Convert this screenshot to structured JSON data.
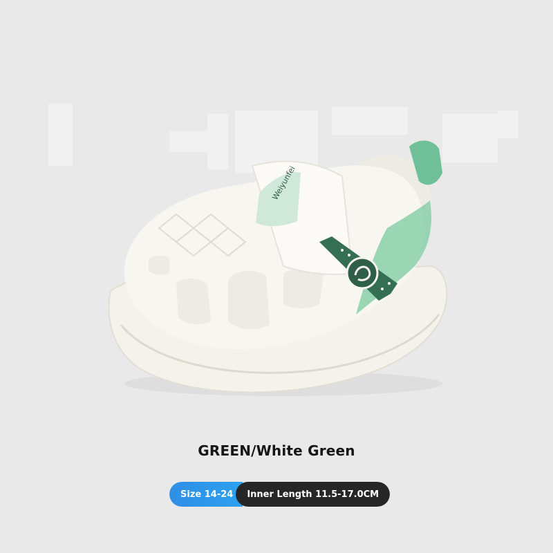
{
  "product": {
    "variant_title": "GREEN/White Green",
    "size_label": "Size 14-24",
    "inner_length_label": "Inner Length 11.5-17.0CM",
    "strap_logo_text": "Weiyunfei",
    "colors": {
      "background": "#e9e9e9",
      "shoe_white": "#f7f5ef",
      "accent_green": "#63b48d",
      "dark_green": "#2f5f49",
      "size_blue": "#2f93e8",
      "length_dark": "#262626"
    }
  }
}
